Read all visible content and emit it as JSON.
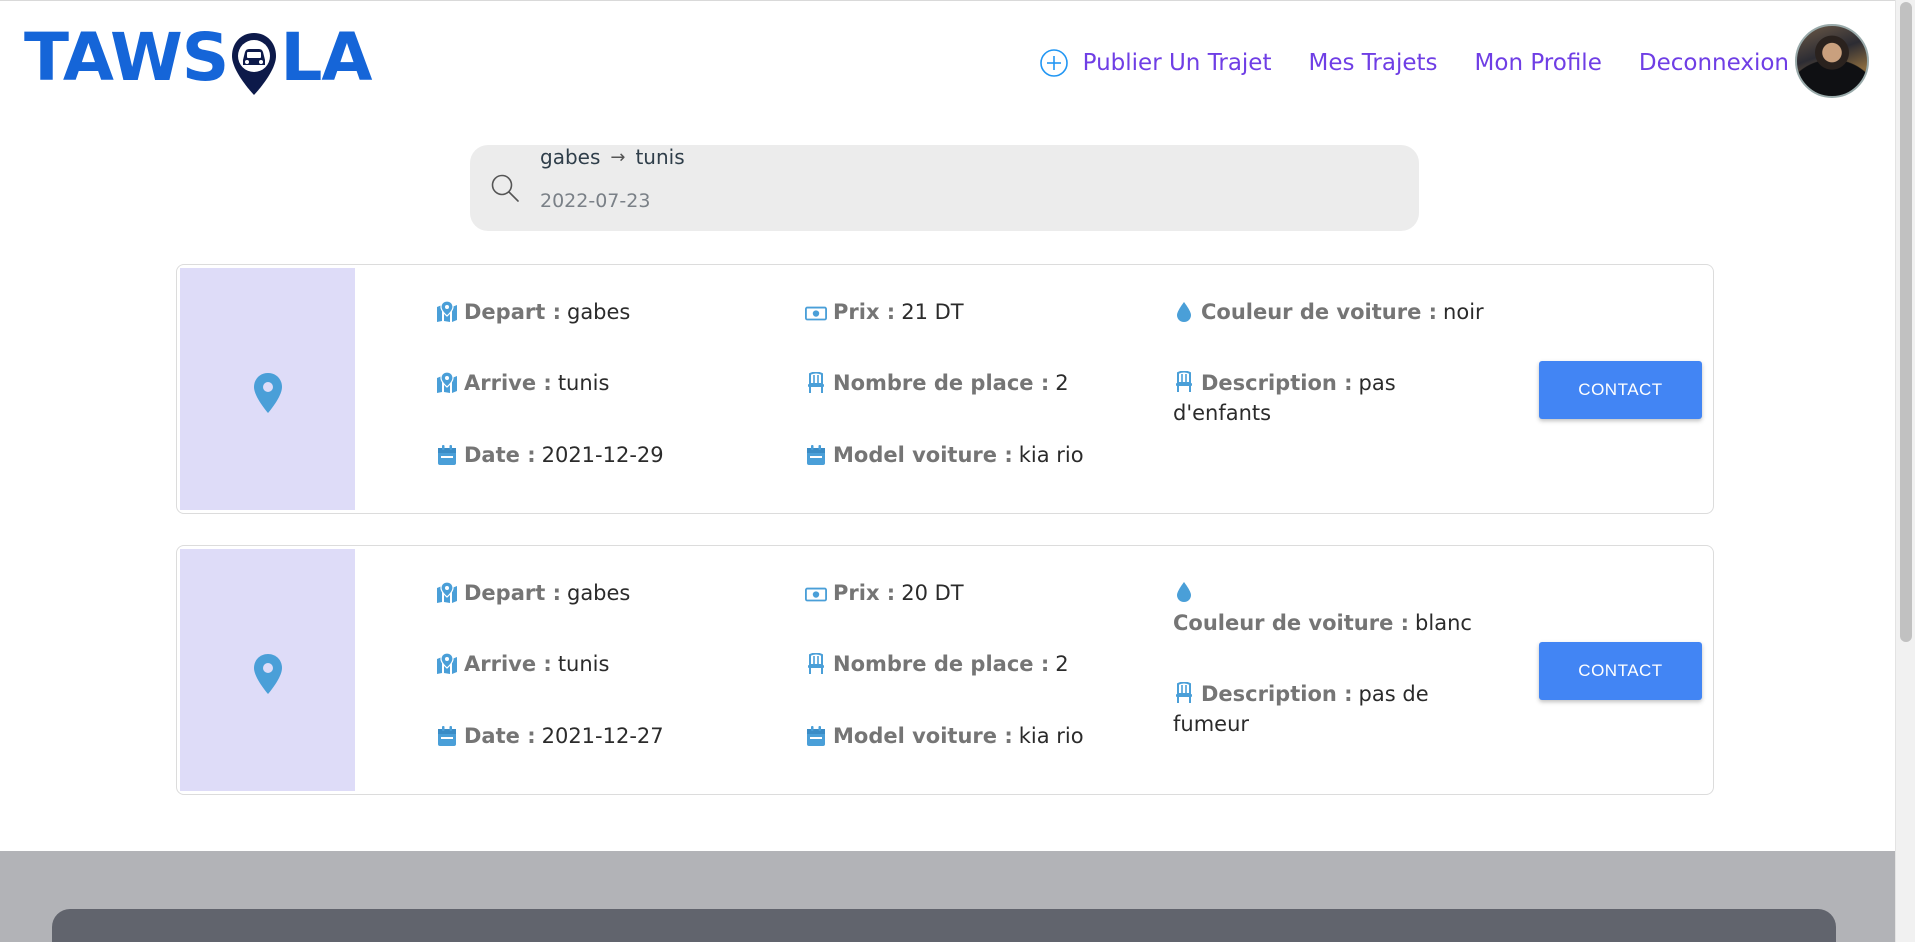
{
  "brand": {
    "logo_part1": "TAWS",
    "logo_part2": "LA"
  },
  "nav": {
    "publish_label": "Publier Un Trajet",
    "my_trips_label": "Mes Trajets",
    "profile_label": "Mon Profile",
    "logout_label": "Deconnexion"
  },
  "search": {
    "from": "gabes",
    "arrow": "→",
    "to": "tunis",
    "date_value": "2022-07-23"
  },
  "labels": {
    "depart": "Depart :",
    "arrive": "Arrive :",
    "date": "Date :",
    "prix": "Prix :",
    "places": "Nombre de place :",
    "model": "Model voiture :",
    "couleur": "Couleur de voiture :",
    "description": "Description :",
    "contact": "CONTACT"
  },
  "trips": [
    {
      "depart": "gabes",
      "arrive": "tunis",
      "date": "2021-12-29",
      "prix": "21 DT",
      "places": "2",
      "model": "kia rio",
      "couleur": "noir",
      "description": "pas d'enfants"
    },
    {
      "depart": "gabes",
      "arrive": "tunis",
      "date": "2021-12-27",
      "prix": "20 DT",
      "places": "2",
      "model": "kia rio",
      "couleur": "blanc",
      "description": "pas de fumeur"
    }
  ],
  "colors": {
    "brand_blue": "#1565d8",
    "nav_purple": "#6f3ee5",
    "icon_blue": "#4a9fd8",
    "button_blue": "#4285f4",
    "thumb_bg": "#dedcf8"
  },
  "icons": {
    "publish": "plus-circle-icon",
    "search": "search-icon",
    "thumb": "map-pin-icon",
    "depart": "map-marked-icon",
    "arrive": "map-marked-icon",
    "date": "calendar-icon",
    "prix": "money-bill-icon",
    "places": "chair-icon",
    "model": "calendar-icon",
    "couleur": "tint-icon",
    "description": "chair-icon"
  }
}
